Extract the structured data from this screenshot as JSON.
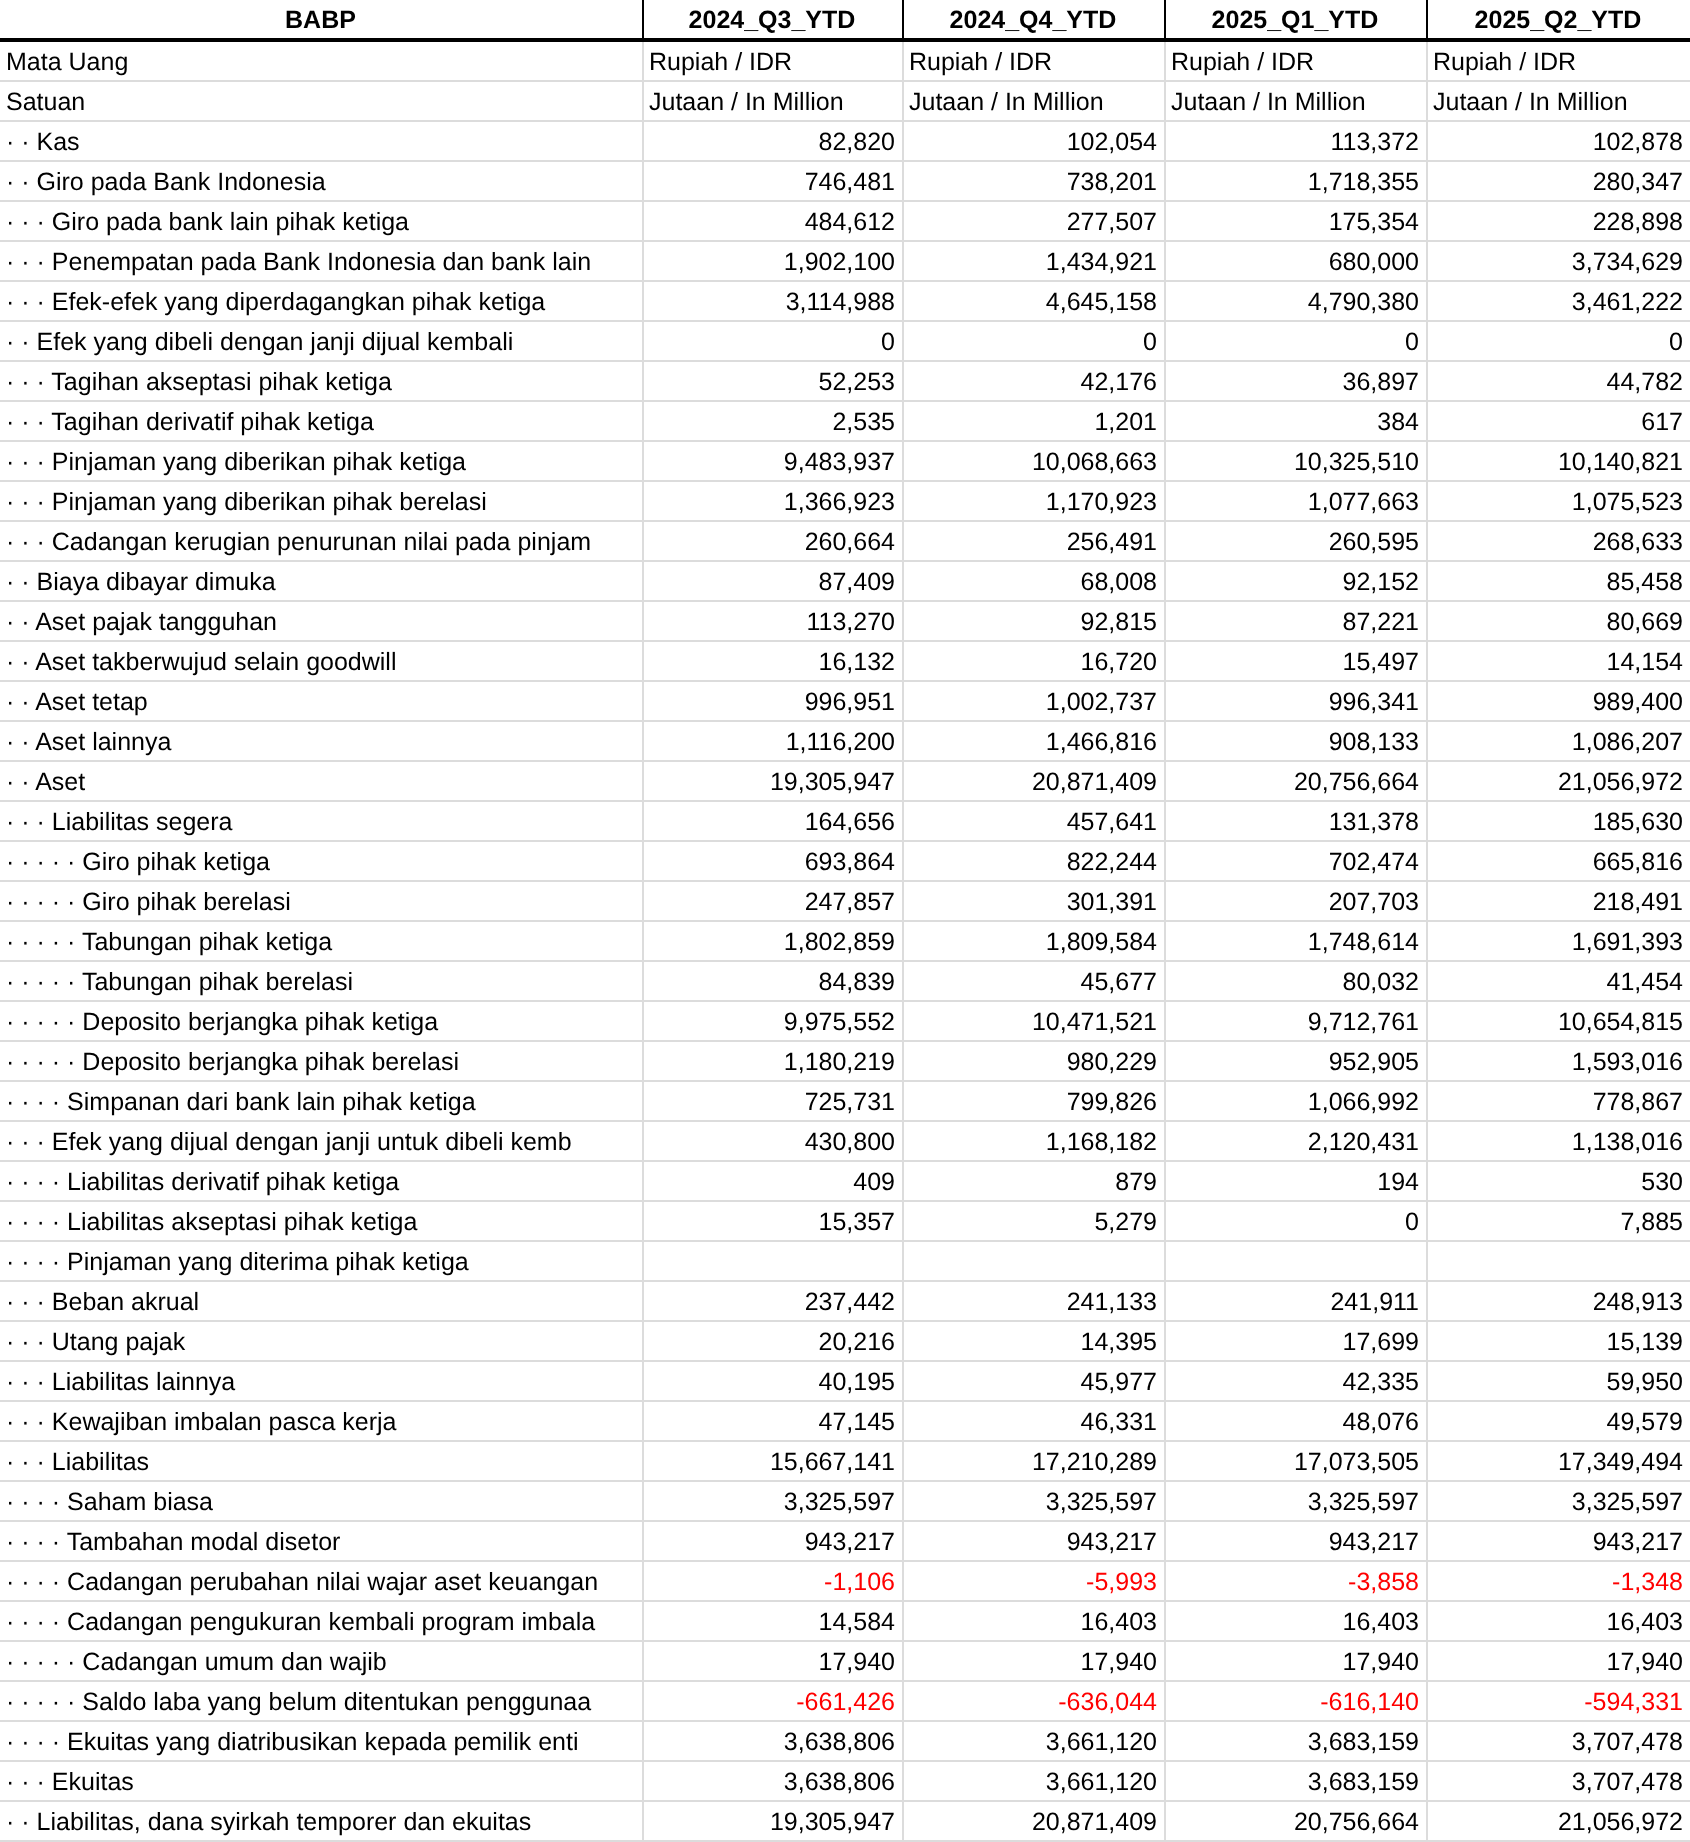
{
  "table": {
    "title": "BABP",
    "columns": [
      "2024_Q3_YTD",
      "2024_Q4_YTD",
      "2025_Q1_YTD",
      "2025_Q2_YTD"
    ],
    "rows": [
      {
        "label": "Mata Uang",
        "values": [
          "Rupiah / IDR",
          "Rupiah / IDR",
          "Rupiah / IDR",
          "Rupiah / IDR"
        ],
        "kind": "unit",
        "negative": false
      },
      {
        "label": "Satuan",
        "values": [
          "Jutaan / In Million",
          "Jutaan / In Million",
          "Jutaan / In Million",
          "Jutaan / In Million"
        ],
        "kind": "unit",
        "negative": false
      },
      {
        "label": "· · Kas",
        "values": [
          "82,820",
          "102,054",
          "113,372",
          "102,878"
        ],
        "kind": "number",
        "negative": false
      },
      {
        "label": "· · Giro pada Bank Indonesia",
        "values": [
          "746,481",
          "738,201",
          "1,718,355",
          "280,347"
        ],
        "kind": "number",
        "negative": false
      },
      {
        "label": "· · · Giro pada bank lain pihak ketiga",
        "values": [
          "484,612",
          "277,507",
          "175,354",
          "228,898"
        ],
        "kind": "number",
        "negative": false
      },
      {
        "label": "· · · Penempatan pada Bank Indonesia dan bank lain",
        "values": [
          "1,902,100",
          "1,434,921",
          "680,000",
          "3,734,629"
        ],
        "kind": "number",
        "negative": false
      },
      {
        "label": "· · · Efek-efek yang diperdagangkan pihak ketiga",
        "values": [
          "3,114,988",
          "4,645,158",
          "4,790,380",
          "3,461,222"
        ],
        "kind": "number",
        "negative": false
      },
      {
        "label": "· · Efek yang dibeli dengan janji dijual kembali",
        "values": [
          "0",
          "0",
          "0",
          "0"
        ],
        "kind": "number",
        "negative": false
      },
      {
        "label": "· · · Tagihan akseptasi pihak ketiga",
        "values": [
          "52,253",
          "42,176",
          "36,897",
          "44,782"
        ],
        "kind": "number",
        "negative": false
      },
      {
        "label": "· · · Tagihan derivatif pihak ketiga",
        "values": [
          "2,535",
          "1,201",
          "384",
          "617"
        ],
        "kind": "number",
        "negative": false
      },
      {
        "label": "· · · Pinjaman yang diberikan pihak ketiga",
        "values": [
          "9,483,937",
          "10,068,663",
          "10,325,510",
          "10,140,821"
        ],
        "kind": "number",
        "negative": false
      },
      {
        "label": "· · · Pinjaman yang diberikan pihak berelasi",
        "values": [
          "1,366,923",
          "1,170,923",
          "1,077,663",
          "1,075,523"
        ],
        "kind": "number",
        "negative": false
      },
      {
        "label": "· · · Cadangan kerugian penurunan nilai pada pinjam",
        "values": [
          "260,664",
          "256,491",
          "260,595",
          "268,633"
        ],
        "kind": "number",
        "negative": false
      },
      {
        "label": "· · Biaya dibayar dimuka",
        "values": [
          "87,409",
          "68,008",
          "92,152",
          "85,458"
        ],
        "kind": "number",
        "negative": false
      },
      {
        "label": "· · Aset pajak tangguhan",
        "values": [
          "113,270",
          "92,815",
          "87,221",
          "80,669"
        ],
        "kind": "number",
        "negative": false
      },
      {
        "label": "· · Aset takberwujud selain goodwill",
        "values": [
          "16,132",
          "16,720",
          "15,497",
          "14,154"
        ],
        "kind": "number",
        "negative": false
      },
      {
        "label": "· · Aset tetap",
        "values": [
          "996,951",
          "1,002,737",
          "996,341",
          "989,400"
        ],
        "kind": "number",
        "negative": false
      },
      {
        "label": "· · Aset lainnya",
        "values": [
          "1,116,200",
          "1,466,816",
          "908,133",
          "1,086,207"
        ],
        "kind": "number",
        "negative": false
      },
      {
        "label": "· · Aset",
        "values": [
          "19,305,947",
          "20,871,409",
          "20,756,664",
          "21,056,972"
        ],
        "kind": "number",
        "negative": false
      },
      {
        "label": "· · · Liabilitas segera",
        "values": [
          "164,656",
          "457,641",
          "131,378",
          "185,630"
        ],
        "kind": "number",
        "negative": false
      },
      {
        "label": "· · · · · Giro pihak ketiga",
        "values": [
          "693,864",
          "822,244",
          "702,474",
          "665,816"
        ],
        "kind": "number",
        "negative": false
      },
      {
        "label": "· · · · · Giro pihak berelasi",
        "values": [
          "247,857",
          "301,391",
          "207,703",
          "218,491"
        ],
        "kind": "number",
        "negative": false
      },
      {
        "label": "· · · · · Tabungan pihak ketiga",
        "values": [
          "1,802,859",
          "1,809,584",
          "1,748,614",
          "1,691,393"
        ],
        "kind": "number",
        "negative": false
      },
      {
        "label": "· · · · · Tabungan pihak berelasi",
        "values": [
          "84,839",
          "45,677",
          "80,032",
          "41,454"
        ],
        "kind": "number",
        "negative": false
      },
      {
        "label": "· · · · · Deposito berjangka pihak ketiga",
        "values": [
          "9,975,552",
          "10,471,521",
          "9,712,761",
          "10,654,815"
        ],
        "kind": "number",
        "negative": false
      },
      {
        "label": "· · · · · Deposito berjangka pihak berelasi",
        "values": [
          "1,180,219",
          "980,229",
          "952,905",
          "1,593,016"
        ],
        "kind": "number",
        "negative": false
      },
      {
        "label": "· · · · Simpanan dari bank lain pihak ketiga",
        "values": [
          "725,731",
          "799,826",
          "1,066,992",
          "778,867"
        ],
        "kind": "number",
        "negative": false
      },
      {
        "label": "· · · Efek yang dijual dengan janji untuk dibeli kemb",
        "values": [
          "430,800",
          "1,168,182",
          "2,120,431",
          "1,138,016"
        ],
        "kind": "number",
        "negative": false
      },
      {
        "label": "· · · · Liabilitas derivatif pihak ketiga",
        "values": [
          "409",
          "879",
          "194",
          "530"
        ],
        "kind": "number",
        "negative": false
      },
      {
        "label": "· · · · Liabilitas akseptasi pihak ketiga",
        "values": [
          "15,357",
          "5,279",
          "0",
          "7,885"
        ],
        "kind": "number",
        "negative": false
      },
      {
        "label": "· · · · Pinjaman yang diterima pihak ketiga",
        "kind": "number"
      },
      {
        "label": "· · · Beban akrual",
        "values": [
          "237,442",
          "241,133",
          "241,911",
          "248,913"
        ],
        "kind": "number",
        "negative": false
      },
      {
        "label": "· · · Utang pajak",
        "values": [
          "20,216",
          "14,395",
          "17,699",
          "15,139"
        ],
        "kind": "number",
        "negative": false
      },
      {
        "label": "· · · Liabilitas lainnya",
        "values": [
          "40,195",
          "45,977",
          "42,335",
          "59,950"
        ],
        "kind": "number",
        "negative": false
      },
      {
        "label": "· · · Kewajiban imbalan pasca kerja",
        "values": [
          "47,145",
          "46,331",
          "48,076",
          "49,579"
        ],
        "kind": "number",
        "negative": false
      },
      {
        "label": "· · · Liabilitas",
        "values": [
          "15,667,141",
          "17,210,289",
          "17,073,505",
          "17,349,494"
        ],
        "kind": "number",
        "negative": false
      },
      {
        "label": "· · · · Saham biasa",
        "values": [
          "3,325,597",
          "3,325,597",
          "3,325,597",
          "3,325,597"
        ],
        "kind": "number",
        "negative": false
      },
      {
        "label": "· · · · Tambahan modal disetor",
        "values": [
          "943,217",
          "943,217",
          "943,217",
          "943,217"
        ],
        "kind": "number",
        "negative": false
      },
      {
        "label": "· · · · Cadangan perubahan nilai wajar aset keuangan",
        "values": [
          "-1,106",
          "-5,993",
          "-3,858",
          "-1,348"
        ],
        "kind": "number",
        "negative": true
      },
      {
        "label": "· · · · Cadangan pengukuran kembali program imbala",
        "values": [
          "14,584",
          "16,403",
          "16,403",
          "16,403"
        ],
        "kind": "number",
        "negative": false
      },
      {
        "label": "· · · · · Cadangan umum dan wajib",
        "values": [
          "17,940",
          "17,940",
          "17,940",
          "17,940"
        ],
        "kind": "number",
        "negative": false
      },
      {
        "label": "· · · · · Saldo laba yang belum ditentukan penggunaa",
        "values": [
          "-661,426",
          "-636,044",
          "-616,140",
          "-594,331"
        ],
        "kind": "number",
        "negative": true
      },
      {
        "label": "· · · · Ekuitas yang diatribusikan kepada pemilik enti",
        "values": [
          "3,638,806",
          "3,661,120",
          "3,683,159",
          "3,707,478"
        ],
        "kind": "number",
        "negative": false
      },
      {
        "label": "· · · Ekuitas",
        "values": [
          "3,638,806",
          "3,661,120",
          "3,683,159",
          "3,707,478"
        ],
        "kind": "number",
        "negative": false
      },
      {
        "label": "· · Liabilitas, dana syirkah temporer dan ekuitas",
        "values": [
          "19,305,947",
          "20,871,409",
          "20,756,664",
          "21,056,972"
        ],
        "kind": "number",
        "negative": false
      }
    ]
  }
}
